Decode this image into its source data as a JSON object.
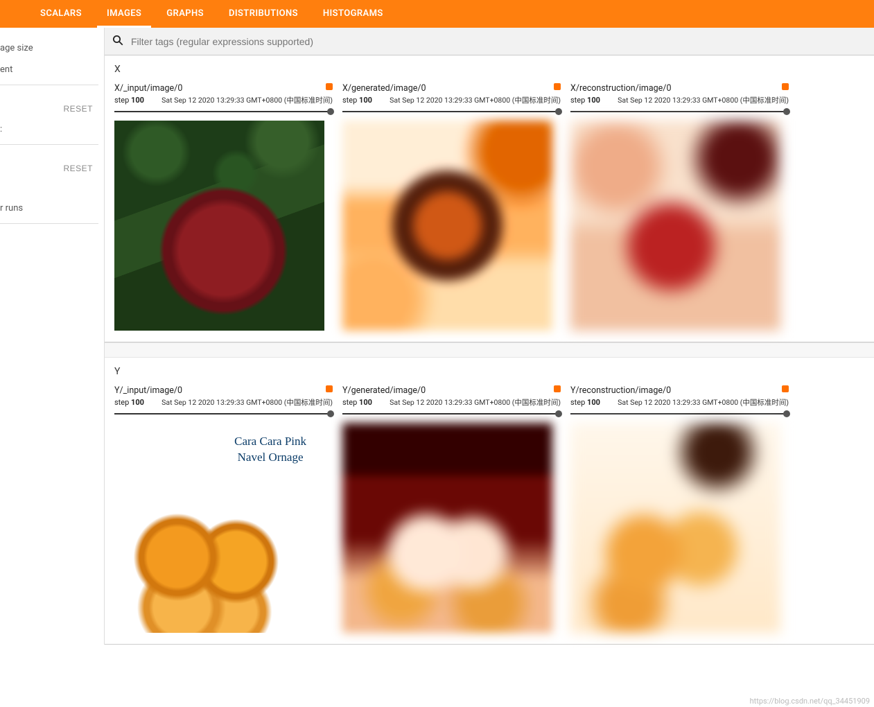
{
  "tabs": {
    "scalars": "SCALARS",
    "images": "IMAGES",
    "graphs": "GRAPHS",
    "distributions": "DISTRIBUTIONS",
    "histograms": "HISTOGRAMS",
    "active": "images"
  },
  "sidebar": {
    "row1": "age size",
    "row2": "ent",
    "reset_label": "RESET",
    "row3": ":",
    "row4": "r runs"
  },
  "search": {
    "placeholder": "Filter tags (regular expressions supported)"
  },
  "sections": [
    {
      "name": "X",
      "cards": [
        {
          "title": "X/_input/image/0",
          "step_label": "step",
          "step": "100",
          "timestamp": "Sat Sep 12 2020 13:29:33 GMT+0800 (中国标准时间)",
          "img_class": "apple"
        },
        {
          "title": "X/generated/image/0",
          "step_label": "step",
          "step": "100",
          "timestamp": "Sat Sep 12 2020 13:29:33 GMT+0800 (中国标准时间)",
          "img_class": "apple-gen"
        },
        {
          "title": "X/reconstruction/image/0",
          "step_label": "step",
          "step": "100",
          "timestamp": "Sat Sep 12 2020 13:29:33 GMT+0800 (中国标准时间)",
          "img_class": "apple-rec"
        }
      ]
    },
    {
      "name": "Y",
      "cards": [
        {
          "title": "Y/_input/image/0",
          "step_label": "step",
          "step": "100",
          "timestamp": "Sat Sep 12 2020 13:29:33 GMT+0800 (中国标准时间)",
          "img_class": "orange",
          "img_text1": "Cara Cara Pink",
          "img_text2": "Navel Ornage"
        },
        {
          "title": "Y/generated/image/0",
          "step_label": "step",
          "step": "100",
          "timestamp": "Sat Sep 12 2020 13:29:33 GMT+0800 (中国标准时间)",
          "img_class": "orange-gen"
        },
        {
          "title": "Y/reconstruction/image/0",
          "step_label": "step",
          "step": "100",
          "timestamp": "Sat Sep 12 2020 13:29:33 GMT+0800 (中国标准时间)",
          "img_class": "orange-rec"
        }
      ]
    }
  ],
  "watermark": "https://blog.csdn.net/qq_34451909"
}
